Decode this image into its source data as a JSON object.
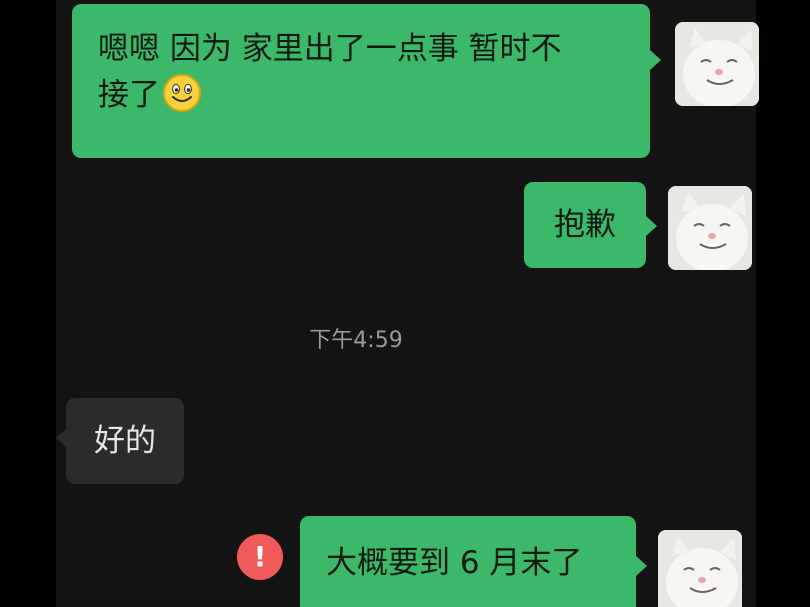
{
  "messages": [
    {
      "direction": "outgoing",
      "line1": "嗯嗯 因为 家里出了一点事 暂时不",
      "line2": "接了",
      "emoji": "smile-emoji"
    },
    {
      "direction": "outgoing",
      "text": "抱歉"
    },
    {
      "direction": "incoming",
      "text": "好的"
    },
    {
      "direction": "outgoing",
      "text": "大概要到 6 月末了",
      "status": "!"
    }
  ],
  "timestamp": "下午4:59",
  "colors": {
    "outgoing_bubble": "#3bb86a",
    "incoming_bubble": "#2b2b2b",
    "background": "#131313",
    "error": "#f05a5a"
  },
  "icons": {
    "avatar": "white-cat-avatar",
    "status": "error-icon"
  }
}
